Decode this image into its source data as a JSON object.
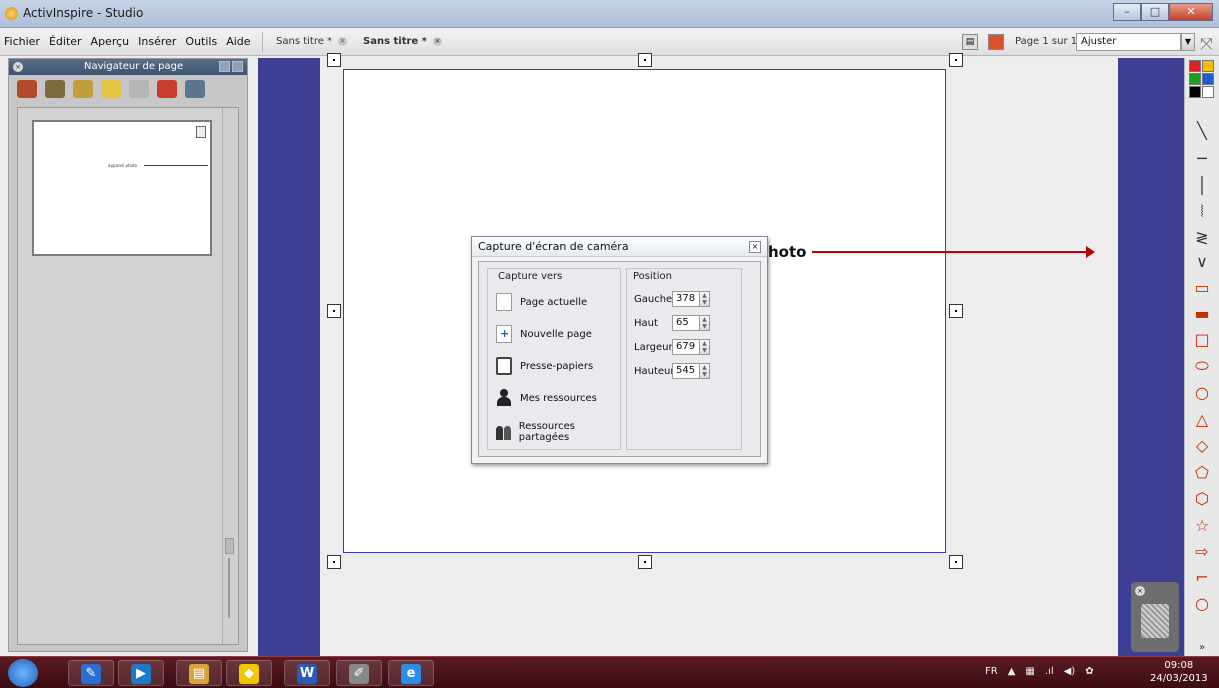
{
  "window": {
    "title": "ActivInspire - Studio"
  },
  "menu": {
    "items": [
      "Fichier",
      "Éditer",
      "Aperçu",
      "Insérer",
      "Outils",
      "Aide"
    ]
  },
  "tabs": [
    {
      "label": "Sans titre *"
    },
    {
      "label": "Sans titre *"
    }
  ],
  "toolbar": {
    "page_info": "Page 1 sur 1",
    "zoom_value": "Ajuster"
  },
  "page_navigator": {
    "title": "Navigateur de page",
    "thumbnail_label": "appareil photo"
  },
  "canvas": {
    "text_suffix": "hoto"
  },
  "dialog": {
    "title": "Capture d'écran de caméra",
    "capture_group_label": "Capture vers",
    "options": [
      "Page actuelle",
      "Nouvelle page",
      "Presse-papiers",
      "Mes ressources",
      "Ressources partagées"
    ],
    "position_group_label": "Position",
    "position": [
      {
        "label": "Gauche",
        "value": "378"
      },
      {
        "label": "Haut",
        "value": "65"
      },
      {
        "label": "Largeur",
        "value": "679"
      },
      {
        "label": "Hauteur",
        "value": "545"
      }
    ]
  },
  "palette_colors": [
    "#e02020",
    "#f0c000",
    "#1da01d",
    "#1f5bd1",
    "#000000",
    "#ffffff"
  ],
  "taskbar": {
    "language": "FR",
    "time": "09:08",
    "date": "24/03/2013",
    "apps": [
      {
        "icon": "paint-icon",
        "glyph": "✎",
        "color": "#2b6fd6"
      },
      {
        "icon": "media-icon",
        "glyph": "▶",
        "color": "#1e7ac9"
      },
      {
        "icon": "explorer-icon",
        "glyph": "▤",
        "color": "#d7a53a"
      },
      {
        "icon": "security-icon",
        "glyph": "◆",
        "color": "#f2c500"
      },
      {
        "icon": "word-icon",
        "glyph": "W",
        "color": "#2a5bb8"
      },
      {
        "icon": "activinspire-icon",
        "glyph": "✐",
        "color": "#888888"
      },
      {
        "icon": "internet-explorer-icon",
        "glyph": "e",
        "color": "#2b8ee6"
      }
    ]
  }
}
